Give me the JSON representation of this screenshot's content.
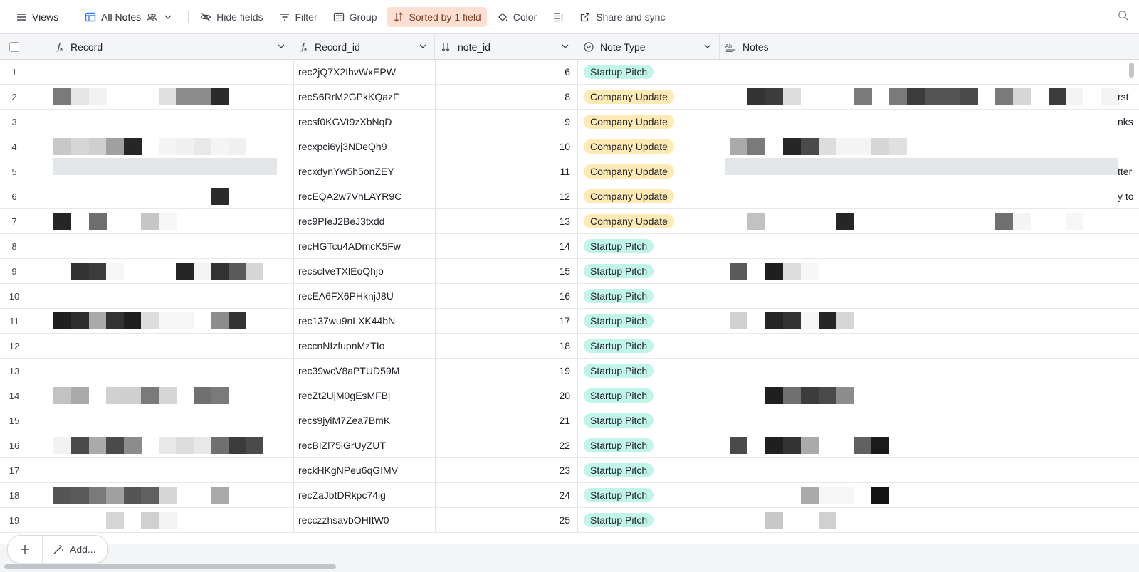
{
  "toolbar": {
    "views_label": "Views",
    "view_name": "All Notes",
    "hide_fields": "Hide fields",
    "filter": "Filter",
    "group": "Group",
    "sorted": "Sorted by 1 field",
    "color": "Color",
    "share": "Share and sync"
  },
  "columns": {
    "record": "Record",
    "record_id": "Record_id",
    "note_id": "note_id",
    "note_type": "Note Type",
    "notes": "Notes"
  },
  "rows": [
    {
      "n": "1",
      "rid": "rec2jQ7X2IhvWxEPW",
      "nid": "6",
      "type": "Startup Pitch"
    },
    {
      "n": "2",
      "rid": "recS6RrM2GPkKQazF",
      "nid": "8",
      "type": "Company Update"
    },
    {
      "n": "3",
      "rid": "recsf0KGVt9zXbNqD",
      "nid": "9",
      "type": "Company Update"
    },
    {
      "n": "4",
      "rid": "recxpci6yj3NDeQh9",
      "nid": "10",
      "type": "Company Update"
    },
    {
      "n": "5",
      "rid": "recxdynYw5h5onZEY",
      "nid": "11",
      "type": "Company Update"
    },
    {
      "n": "6",
      "rid": "recEQA2w7VhLAYR9C",
      "nid": "12",
      "type": "Company Update"
    },
    {
      "n": "7",
      "rid": "rec9PIeJ2BeJ3txdd",
      "nid": "13",
      "type": "Company Update"
    },
    {
      "n": "8",
      "rid": "recHGTcu4ADmcK5Fw",
      "nid": "14",
      "type": "Startup Pitch"
    },
    {
      "n": "9",
      "rid": "recscIveTXlEoQhjb",
      "nid": "15",
      "type": "Startup Pitch"
    },
    {
      "n": "10",
      "rid": "recEA6FX6PHknjJ8U",
      "nid": "16",
      "type": "Startup Pitch"
    },
    {
      "n": "11",
      "rid": "rec137wu9nLXK44bN",
      "nid": "17",
      "type": "Startup Pitch"
    },
    {
      "n": "12",
      "rid": "reccnNIzfupnMzTIo",
      "nid": "18",
      "type": "Startup Pitch"
    },
    {
      "n": "13",
      "rid": "rec39wcV8aPTUD59M",
      "nid": "19",
      "type": "Startup Pitch"
    },
    {
      "n": "14",
      "rid": "recZt2UjM0gEsMFBj",
      "nid": "20",
      "type": "Startup Pitch"
    },
    {
      "n": "15",
      "rid": "recs9jyiM7Zea7BmK",
      "nid": "21",
      "type": "Startup Pitch"
    },
    {
      "n": "16",
      "rid": "recBIZl75iGrUyZUT",
      "nid": "22",
      "type": "Startup Pitch"
    },
    {
      "n": "17",
      "rid": "reckHKgNPeu6qGIMV",
      "nid": "23",
      "type": "Startup Pitch"
    },
    {
      "n": "18",
      "rid": "recZaJbtDRkpc74ig",
      "nid": "24",
      "type": "Startup Pitch"
    },
    {
      "n": "19",
      "rid": "recczzhsavbOHItW0",
      "nid": "25",
      "type": "Startup Pitch"
    }
  ],
  "overflow_fragments": {
    "r2": "rst ",
    "r3": "nks",
    "r5": "tter",
    "r6": "y to"
  },
  "bottom": {
    "add_label": "Add..."
  },
  "colors": {
    "startup_pill": "#c2f5e9",
    "company_pill": "#ffeab6",
    "sorted_bg": "#ffdfd2"
  }
}
